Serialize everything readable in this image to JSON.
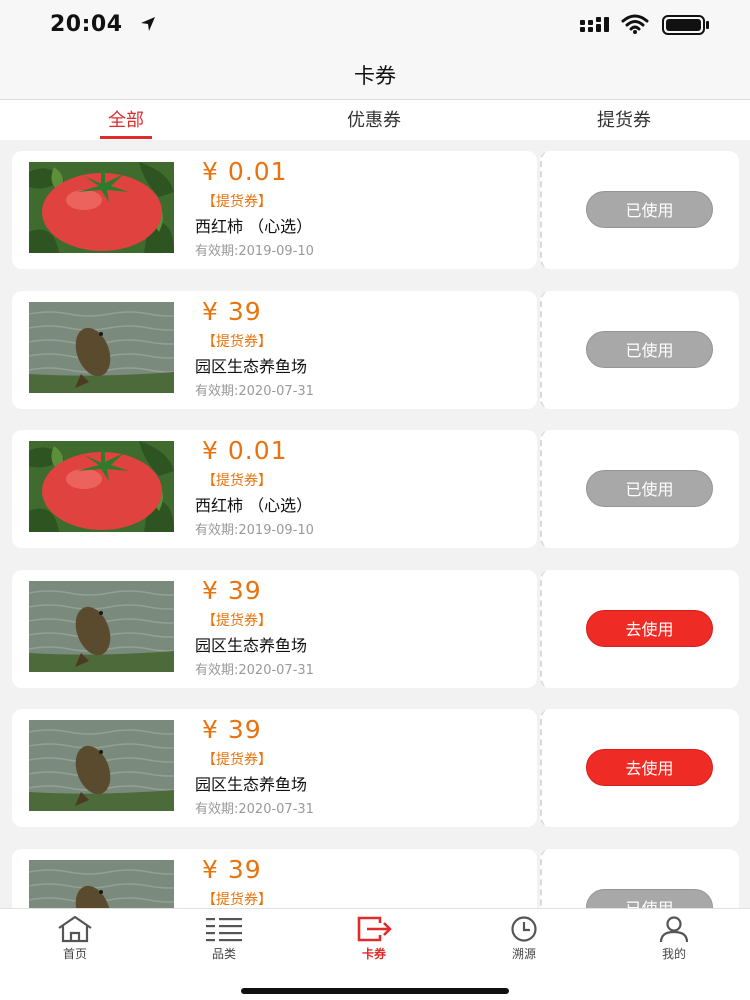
{
  "status_bar": {
    "time": "20:04"
  },
  "nav": {
    "title": "卡券"
  },
  "tabs": [
    {
      "label": "全部"
    },
    {
      "label": "优惠券"
    },
    {
      "label": "提货券"
    }
  ],
  "coupons": [
    {
      "price": "¥ 0.01",
      "type": "【提货券】",
      "name": "西红柿 （心选）",
      "validity": "有效期:2019-09-10",
      "button": "已使用",
      "image": "tomato",
      "status": "used"
    },
    {
      "price": "¥ 39",
      "type": "【提货券】",
      "name": "园区生态养鱼场",
      "validity": "有效期:2020-07-31",
      "button": "已使用",
      "image": "fish",
      "status": "used"
    },
    {
      "price": "¥ 0.01",
      "type": "【提货券】",
      "name": "西红柿 （心选）",
      "validity": "有效期:2019-09-10",
      "button": "已使用",
      "image": "tomato",
      "status": "used"
    },
    {
      "price": "¥ 39",
      "type": "【提货券】",
      "name": "园区生态养鱼场",
      "validity": "有效期:2020-07-31",
      "button": "去使用",
      "image": "fish",
      "status": "active"
    },
    {
      "price": "¥ 39",
      "type": "【提货券】",
      "name": "园区生态养鱼场",
      "validity": "有效期:2020-07-31",
      "button": "去使用",
      "image": "fish",
      "status": "active"
    },
    {
      "price": "¥ 39",
      "type": "【提货券】",
      "name": "",
      "validity": "",
      "button": "已使用",
      "image": "fish",
      "status": "used"
    }
  ],
  "tab_bar": [
    {
      "label": "首页",
      "icon": "home-icon"
    },
    {
      "label": "品类",
      "icon": "category-icon"
    },
    {
      "label": "卡券",
      "icon": "coupon-icon"
    },
    {
      "label": "溯源",
      "icon": "clock-icon"
    },
    {
      "label": "我的",
      "icon": "user-icon"
    }
  ],
  "colors": {
    "accent": "#e02b2b",
    "price": "#e8740f",
    "used_button": "#a8a8a8",
    "active_button": "#ee2b24"
  }
}
